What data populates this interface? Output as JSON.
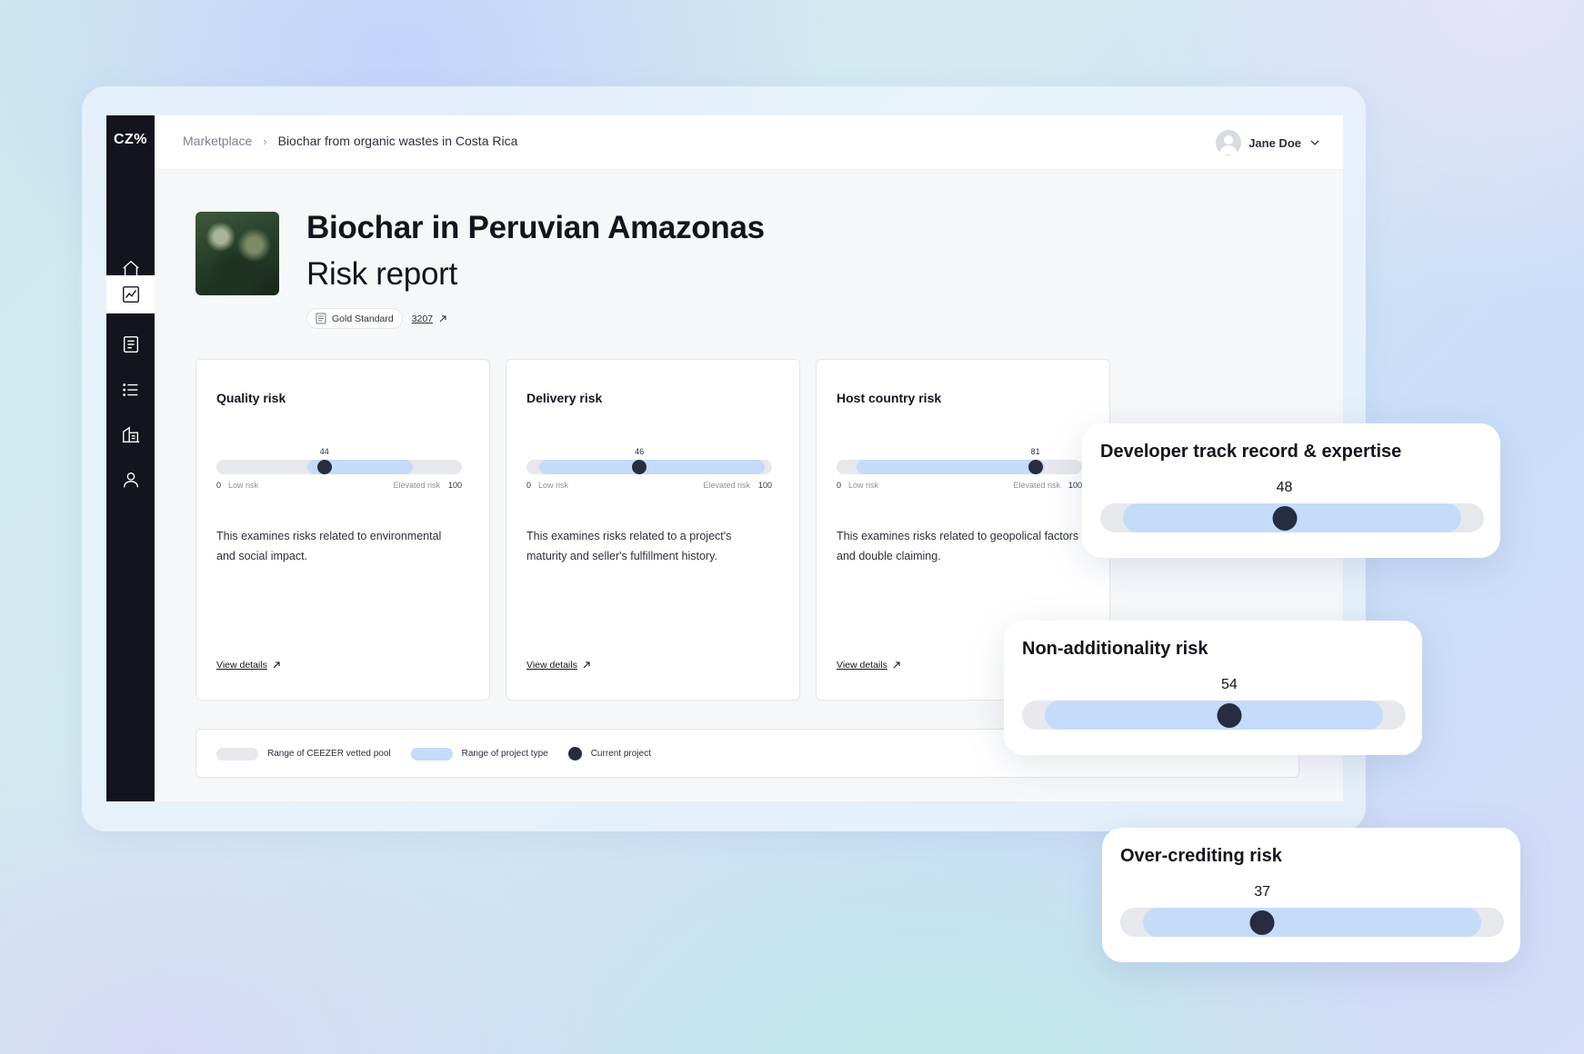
{
  "app": {
    "logo": "CZ%",
    "nav": [
      {
        "icon": "home-icon"
      },
      {
        "icon": "chart-icon",
        "active": true
      },
      {
        "icon": "document-icon"
      },
      {
        "icon": "list-icon"
      },
      {
        "icon": "buildings-icon"
      },
      {
        "icon": "user-icon"
      }
    ]
  },
  "topbar": {
    "breadcrumb": {
      "root": "Marketplace",
      "separator": "›",
      "current": "Biochar from organic wastes in Costa Rica"
    },
    "user": {
      "name": "Jane Doe",
      "icon": "chevron-down-icon"
    }
  },
  "header": {
    "title": "Biochar in Peruvian Amazonas",
    "subtitle": "Risk report",
    "tag_label": "Gold Standard",
    "registry_id": "3207"
  },
  "cards": [
    {
      "title": "Quality risk",
      "score": 44,
      "range_min": 37,
      "range_max": 80,
      "scale_min": "0",
      "scale_low": "Low risk",
      "scale_elev": "Elevated risk",
      "scale_max": "100",
      "description": "This examines risks related to environmental and social impact.",
      "link": "View details"
    },
    {
      "title": "Delivery risk",
      "score": 46,
      "range_min": 5,
      "range_max": 97,
      "scale_min": "0",
      "scale_low": "Low risk",
      "scale_elev": "Elevated risk",
      "scale_max": "100",
      "description": "This examines risks related to a project's maturity and seller's fulfillment history.",
      "link": "View details"
    },
    {
      "title": "Host country risk",
      "score": 81,
      "range_min": 8,
      "range_max": 85,
      "scale_min": "0",
      "scale_low": "Low risk",
      "scale_elev": "Elevated risk",
      "scale_max": "100",
      "description": "This examines risks related to geopolical factors and double claiming.",
      "link": "View details"
    }
  ],
  "legend": [
    {
      "label": "Range of CEEZER vetted pool",
      "color": "#e7e8ec"
    },
    {
      "label": "Range of project type",
      "color": "#c4dbfa"
    },
    {
      "label": "Current project",
      "color": "#262d40"
    }
  ],
  "floating": [
    {
      "title": "Developer track record & expertise",
      "score": 48,
      "range_min": 6,
      "range_max": 94
    },
    {
      "title": "Non-additionality risk",
      "score": 54,
      "range_min": 6,
      "range_max": 94
    },
    {
      "title": "Over-crediting risk",
      "score": 37,
      "range_min": 6,
      "range_max": 94
    }
  ],
  "colors": {
    "sidebar": "#14141f",
    "pool_range": "#e7e8ec",
    "project_range": "#c4dbfa",
    "current_marker": "#262d40"
  }
}
